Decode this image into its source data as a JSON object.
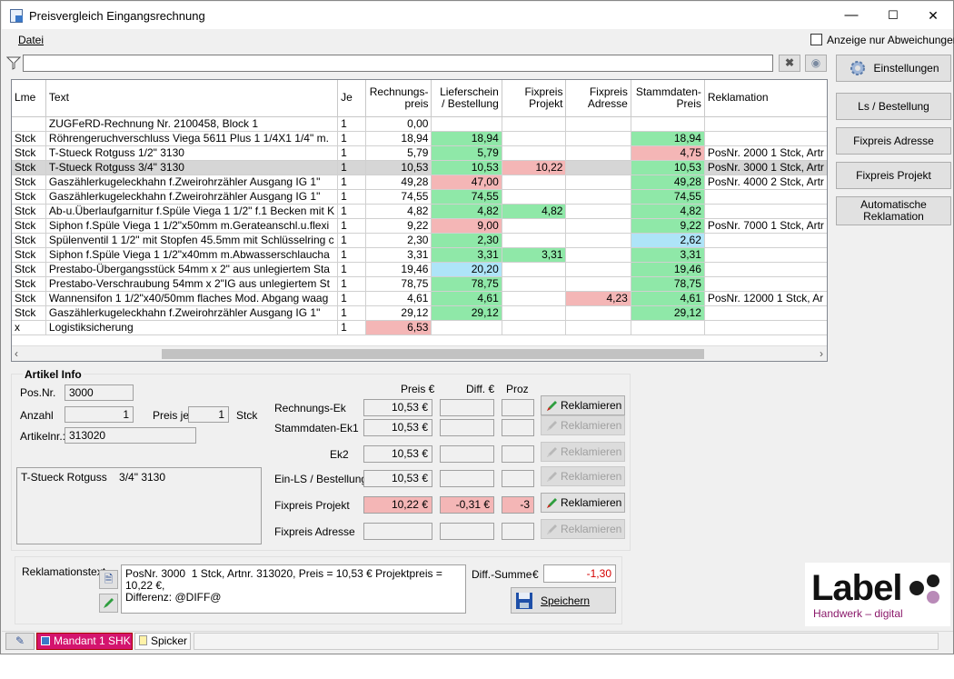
{
  "window": {
    "title": "Preisvergleich Eingangsrechnung",
    "minimize": "—",
    "maximize": "☐",
    "close": "✕"
  },
  "menu": {
    "datei": "Datei"
  },
  "toolbar": {
    "only_diff_label": "Anzeige nur Abweichungen",
    "only_diff_checked": false,
    "filter_value": ""
  },
  "side_buttons": {
    "einstellungen": "Einstellungen",
    "ls_bestellung": "Ls / Bestellung",
    "fixpreis_adresse": "Fixpreis Adresse",
    "fixpreis_projekt": "Fixpreis Projekt",
    "auto_reklamation": "Automatische Reklamation"
  },
  "grid": {
    "columns": [
      "Lme",
      "Text",
      "Je",
      "Rechnungs-preis",
      "Lieferschein / Bestellung",
      "Fixpreis Projekt",
      "Fixpreis Adresse",
      "Stammdaten-Preis",
      "Reklamation"
    ],
    "rows": [
      {
        "lme": "",
        "text": "ZUGFeRD-Rechnung Nr. 2100458, Block 1",
        "je": "1",
        "rp": "0,00",
        "ls": "",
        "fp": "",
        "fa": "",
        "sp": "",
        "rek": "",
        "c": [
          "",
          "",
          "",
          "",
          ""
        ]
      },
      {
        "lme": "Stck",
        "text": "Röhrengeruchverschluss Viega 5611 Plus 1 1/4X1 1/4\" m.",
        "je": "1",
        "rp": "18,94",
        "ls": "18,94",
        "fp": "",
        "fa": "",
        "sp": "18,94",
        "rek": "",
        "c": [
          "",
          "g",
          "",
          "",
          "g"
        ]
      },
      {
        "lme": "Stck",
        "text": "T-Stueck Rotguss    1/2\" 3130",
        "je": "1",
        "rp": "5,79",
        "ls": "5,79",
        "fp": "",
        "fa": "",
        "sp": "4,75",
        "rek": "PosNr. 2000  1 Stck, Artr",
        "c": [
          "",
          "g",
          "",
          "",
          "r"
        ]
      },
      {
        "lme": "Stck",
        "text": "T-Stueck Rotguss    3/4\" 3130",
        "je": "1",
        "rp": "10,53",
        "ls": "10,53",
        "fp": "10,22",
        "fa": "",
        "sp": "10,53",
        "rek": "PosNr. 3000  1 Stck, Artr",
        "c": [
          "",
          "g",
          "r",
          "",
          "g"
        ],
        "sel": true
      },
      {
        "lme": "Stck",
        "text": "Gaszählerkugeleckhahn f.Zweirohrzähler Ausgang IG    1\"",
        "je": "1",
        "rp": "49,28",
        "ls": "47,00",
        "fp": "",
        "fa": "",
        "sp": "49,28",
        "rek": "PosNr. 4000  2 Stck, Artr",
        "c": [
          "",
          "r",
          "",
          "",
          "g"
        ]
      },
      {
        "lme": "Stck",
        "text": "Gaszählerkugeleckhahn f.Zweirohrzähler Ausgang IG    1\"",
        "je": "1",
        "rp": "74,55",
        "ls": "74,55",
        "fp": "",
        "fa": "",
        "sp": "74,55",
        "rek": "",
        "c": [
          "",
          "g",
          "",
          "",
          "g"
        ]
      },
      {
        "lme": "Stck",
        "text": "Ab-u.Überlaufgarnitur f.Spüle Viega 1 1/2\" f.1 Becken mit K",
        "je": "1",
        "rp": "4,82",
        "ls": "4,82",
        "fp": "4,82",
        "fa": "",
        "sp": "4,82",
        "rek": "",
        "c": [
          "",
          "g",
          "g",
          "",
          "g"
        ]
      },
      {
        "lme": "Stck",
        "text": "Siphon f.Spüle Viega 1 1/2\"x50mm m.Gerateanschl.u.flexi",
        "je": "1",
        "rp": "9,22",
        "ls": "9,00",
        "fp": "",
        "fa": "",
        "sp": "9,22",
        "rek": "PosNr. 7000  1 Stck, Artr",
        "c": [
          "",
          "r",
          "",
          "",
          "g"
        ]
      },
      {
        "lme": "Stck",
        "text": "Spülenventil 1 1/2\" mit Stopfen 45.5mm mit Schlüsselring c",
        "je": "1",
        "rp": "2,30",
        "ls": "2,30",
        "fp": "",
        "fa": "",
        "sp": "2,62",
        "rek": "",
        "c": [
          "",
          "g",
          "",
          "",
          "b"
        ]
      },
      {
        "lme": "Stck",
        "text": "Siphon f.Spüle Viega 1 1/2\"x40mm m.Abwasserschlaucha",
        "je": "1",
        "rp": "3,31",
        "ls": "3,31",
        "fp": "3,31",
        "fa": "",
        "sp": "3,31",
        "rek": "",
        "c": [
          "",
          "g",
          "g",
          "",
          "g"
        ]
      },
      {
        "lme": "Stck",
        "text": "Prestabo-Übergangsstück 54mm x 2\" aus unlegiertem Sta",
        "je": "1",
        "rp": "19,46",
        "ls": "20,20",
        "fp": "",
        "fa": "",
        "sp": "19,46",
        "rek": "",
        "c": [
          "",
          "b",
          "",
          "",
          "g"
        ]
      },
      {
        "lme": "Stck",
        "text": "Prestabo-Verschraubung 54mm x 2\"IG aus unlegiertem St",
        "je": "1",
        "rp": "78,75",
        "ls": "78,75",
        "fp": "",
        "fa": "",
        "sp": "78,75",
        "rek": "",
        "c": [
          "",
          "g",
          "",
          "",
          "g"
        ]
      },
      {
        "lme": "Stck",
        "text": "Wannensifon 1 1/2\"x40/50mm flaches Mod. Abgang waag",
        "je": "1",
        "rp": "4,61",
        "ls": "4,61",
        "fp": "",
        "fa": "4,23",
        "sp": "4,61",
        "rek": "PosNr. 12000  1 Stck, Ar",
        "c": [
          "",
          "g",
          "",
          "r",
          "g"
        ]
      },
      {
        "lme": "Stck",
        "text": "Gaszählerkugeleckhahn f.Zweirohrzähler Ausgang IG    1\"",
        "je": "1",
        "rp": "29,12",
        "ls": "29,12",
        "fp": "",
        "fa": "",
        "sp": "29,12",
        "rek": "",
        "c": [
          "",
          "g",
          "",
          "",
          "g"
        ]
      },
      {
        "lme": "x",
        "text": "Logistiksicherung",
        "je": "1",
        "rp": "6,53",
        "ls": "",
        "fp": "",
        "fa": "",
        "sp": "",
        "rek": "",
        "c": [
          "r",
          "",
          "",
          "",
          ""
        ]
      }
    ]
  },
  "artikel": {
    "group_title": "Artikel Info",
    "posnr_label": "Pos.Nr.",
    "posnr": "3000",
    "anzahl_label": "Anzahl",
    "anzahl": "1",
    "preis_je_label": "Preis je",
    "preis_je": "1",
    "unit": "Stck",
    "artnr_label": "Artikelnr.:",
    "artnr": "313020",
    "description": "T-Stueck Rotguss    3/4\" 3130",
    "col_preis": "Preis €",
    "col_diff": "Diff. €",
    "col_proz": "Proz",
    "rows": [
      {
        "label": "Rechnungs-Ek",
        "preis": "10,53 €",
        "diff": "",
        "proz": "",
        "btn": "Reklamieren"
      },
      {
        "label": "Stammdaten-Ek1",
        "preis": "10,53 €",
        "diff": "",
        "proz": "",
        "btn": "Reklamieren"
      },
      {
        "label": "Ek2",
        "preis": "10,53 €",
        "diff": "",
        "proz": "",
        "btn": "Reklamieren"
      },
      {
        "label": "Ein-LS / Bestellung",
        "preis": "10,53 €",
        "diff": "",
        "proz": "",
        "btn": "Reklamieren"
      },
      {
        "label": "Fixpreis Projekt",
        "preis": "10,22 €",
        "diff": "-0,31 €",
        "proz": "-3",
        "btn": "Reklamieren"
      },
      {
        "label": "Fixpreis Adresse",
        "preis": "",
        "diff": "",
        "proz": "",
        "btn": "Reklamieren"
      }
    ]
  },
  "reklamation": {
    "label": "Reklamationstext",
    "text": "PosNr. 3000  1 Stck, Artnr. 313020, Preis = 10,53 € Projektpreis = 10,22 €,\nDifferenz: @DIFF@",
    "diff_sum_label": "Diff.-Summe",
    "currency": "€",
    "diff_sum": "-1,30",
    "save_label": "Speichern"
  },
  "status": {
    "mandant": "Mandant 1 SHK",
    "spicker": "Spicker"
  },
  "logo": {
    "name": "Label",
    "tagline": "Handwerk – digital"
  },
  "colors": {
    "green": "#8fe8a8",
    "red": "#f4b6b6",
    "blue": "#aee4f8",
    "accent": "#d4146e",
    "logo_purple": "#8b1a6b"
  }
}
